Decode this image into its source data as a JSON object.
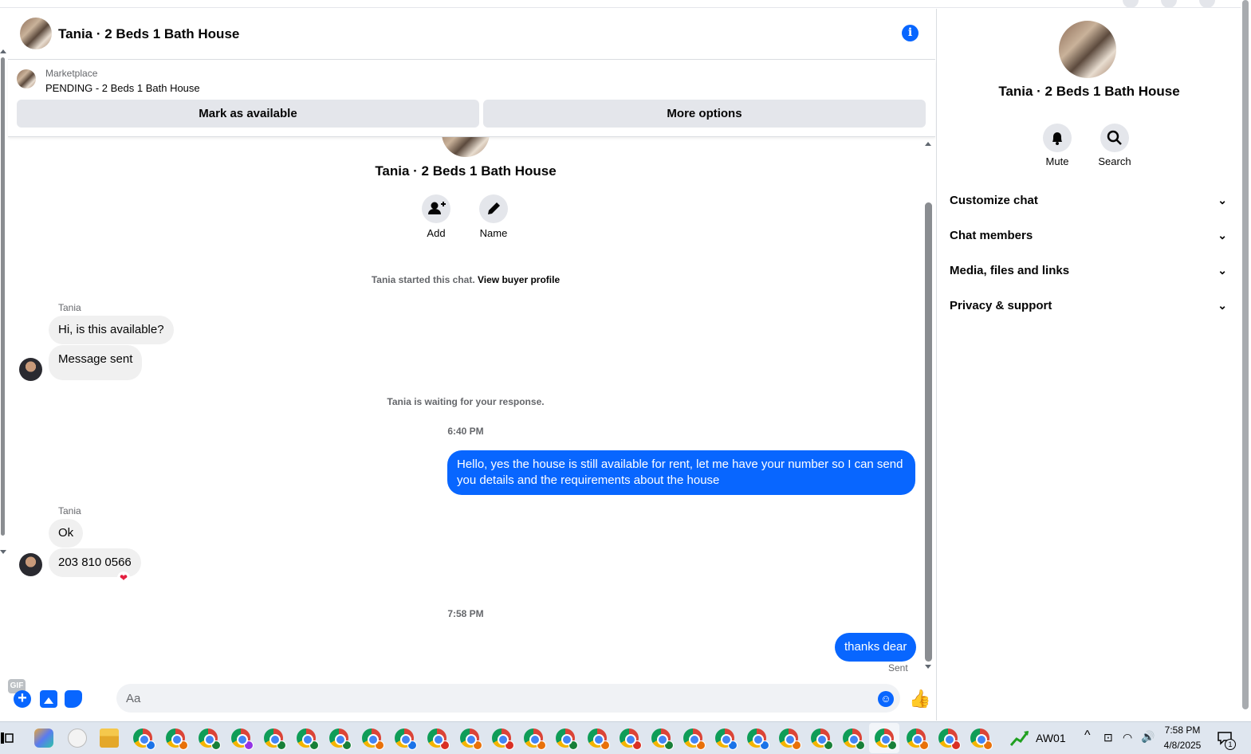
{
  "chat": {
    "title": "Tania · 2 Beds 1 Bath House"
  },
  "marketplace": {
    "label": "Marketplace",
    "listing": "PENDING - 2 Beds 1 Bath House",
    "mark_available": "Mark as available",
    "more_options": "More options"
  },
  "intro": {
    "title": "Tania · 2 Beds 1 Bath House",
    "add_label": "Add",
    "name_label": "Name",
    "started_note": "Tania started this chat.",
    "view_profile": "View buyer profile"
  },
  "messages": {
    "sender_1": "Tania",
    "msg_1": "Hi, is this available?",
    "msg_2": "Message sent",
    "waiting_note": "Tania is waiting for your response.",
    "time_1": "6:40 PM",
    "msg_3_line1": "Hello, yes the house is still available for rent, let me have your number so I can send",
    "msg_3_line2": "you details and the requirements about the house",
    "sender_2": "Tania",
    "msg_4": "Ok",
    "msg_5": "203 810 0566",
    "reaction": "❤",
    "time_2": "7:58 PM",
    "msg_6": "thanks dear",
    "status": "Sent"
  },
  "composer": {
    "placeholder": "Aa",
    "gif_label": "GIF"
  },
  "right_panel": {
    "title": "Tania · 2 Beds 1 Bath House",
    "mute_label": "Mute",
    "search_label": "Search",
    "sections": [
      "Customize chat",
      "Chat members",
      "Media, files and links",
      "Privacy & support"
    ]
  },
  "taskbar": {
    "tray_label": "AW01",
    "time": "7:58 PM",
    "date": "4/8/2025",
    "notification_count": "1"
  },
  "colors": {
    "accent": "#0866ff",
    "bubble_in": "#f0f0f0",
    "secondary_text": "#65676b"
  }
}
